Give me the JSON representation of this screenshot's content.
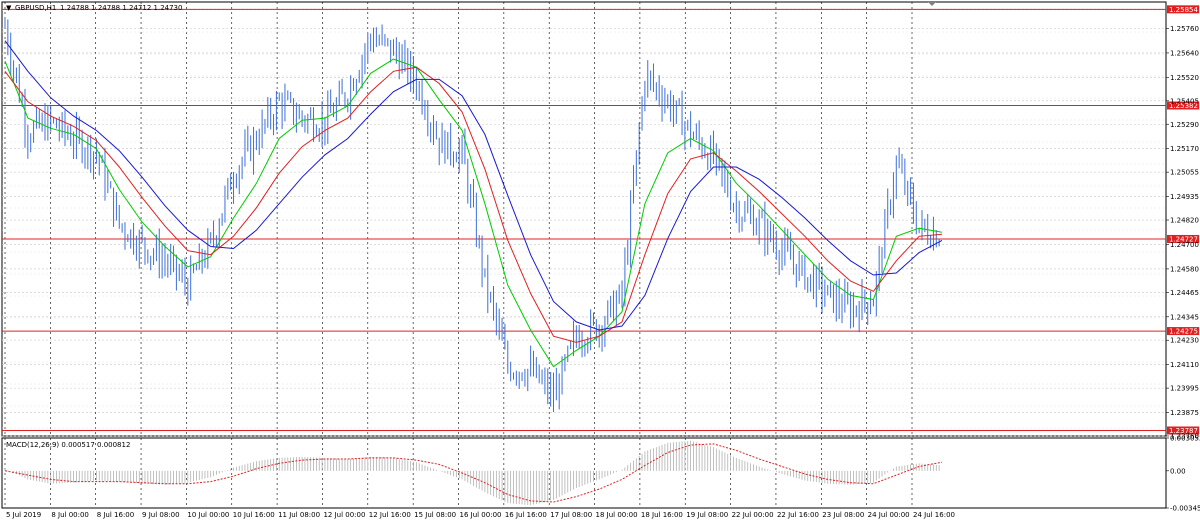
{
  "header": {
    "symbol": "GBPUSD,H1",
    "ohlc": "1.24788 1.24788 1.24712 1.24730"
  },
  "macd_header": "MACD(12,26,9) 0.000517 0.000812",
  "colors": {
    "candle": "#3d6fd9",
    "ma_fast": "#00cc00",
    "ma_mid": "#e02020",
    "ma_slow": "#1a1ad0",
    "level_line": "#e02020",
    "level_label_bg": "#e02020",
    "grid": "#c8c8c8",
    "macd_hist": "#b0b0b0",
    "macd_signal": "#e02020"
  },
  "chart_data": [
    {
      "type": "line",
      "name": "price",
      "ylim": [
        1.2376,
        1.2589
      ],
      "y_ticks": [
        "1.25760",
        "1.25640",
        "1.25520",
        "1.25405",
        "1.25290",
        "1.25170",
        "1.25055",
        "1.24935",
        "1.24820",
        "1.24700",
        "1.24580",
        "1.24465",
        "1.24345",
        "1.24230",
        "1.24110",
        "1.23995",
        "1.23875",
        "1.23760"
      ],
      "x_ticks": [
        "5 Jul 2019",
        "8 Jul 00:00",
        "8 Jul 16:00",
        "9 Jul 08:00",
        "10 Jul 00:00",
        "10 Jul 16:00",
        "11 Jul 08:00",
        "12 Jul 00:00",
        "12 Jul 16:00",
        "15 Jul 08:00",
        "16 Jul 00:00",
        "16 Jul 16:00",
        "17 Jul 08:00",
        "18 Jul 00:00",
        "18 Jul 16:00",
        "19 Jul 08:00",
        "22 Jul 00:00",
        "22 Jul 16:00",
        "23 Jul 08:00",
        "24 Jul 00:00",
        "24 Jul 16:00"
      ],
      "x": [
        "5 Jul 2019",
        "5 Jul 16:00",
        "8 Jul 00:00",
        "8 Jul 08:00",
        "8 Jul 16:00",
        "9 Jul 00:00",
        "9 Jul 08:00",
        "9 Jul 16:00",
        "10 Jul 00:00",
        "10 Jul 08:00",
        "10 Jul 16:00",
        "11 Jul 00:00",
        "11 Jul 08:00",
        "11 Jul 16:00",
        "12 Jul 00:00",
        "12 Jul 08:00",
        "12 Jul 16:00",
        "15 Jul 00:00",
        "15 Jul 08:00",
        "15 Jul 16:00",
        "16 Jul 00:00",
        "16 Jul 08:00",
        "16 Jul 16:00",
        "17 Jul 00:00",
        "17 Jul 08:00",
        "17 Jul 16:00",
        "18 Jul 00:00",
        "18 Jul 08:00",
        "18 Jul 16:00",
        "19 Jul 00:00",
        "19 Jul 08:00",
        "19 Jul 16:00",
        "22 Jul 00:00",
        "22 Jul 08:00",
        "22 Jul 16:00",
        "23 Jul 00:00",
        "23 Jul 08:00",
        "23 Jul 16:00",
        "24 Jul 00:00",
        "24 Jul 08:00",
        "24 Jul 16:00",
        "25 Jul 00:00"
      ],
      "series": [
        {
          "values": [
            1.2577,
            1.2525,
            1.253,
            1.2522,
            1.2515,
            1.248,
            1.247,
            1.2462,
            1.245,
            1.247,
            1.2505,
            1.2522,
            1.254,
            1.2532,
            1.253,
            1.2545,
            1.2572,
            1.2565,
            1.255,
            1.252,
            1.2515,
            1.2452,
            1.241,
            1.2408,
            1.2395,
            1.2425,
            1.243,
            1.2445,
            1.2553,
            1.254,
            1.2525,
            1.2512,
            1.2488,
            1.248,
            1.2467,
            1.2455,
            1.2445,
            1.2438,
            1.2444,
            1.251,
            1.2478,
            1.2474
          ]
        },
        {
          "name": "MA fast",
          "values": [
            1.256,
            1.2532,
            1.2527,
            1.2524,
            1.2517,
            1.2497,
            1.2481,
            1.2469,
            1.2459,
            1.2464,
            1.2483,
            1.25,
            1.2522,
            1.2531,
            1.2532,
            1.2538,
            1.2554,
            1.2561,
            1.2557,
            1.2541,
            1.2526,
            1.249,
            1.245,
            1.2428,
            1.241,
            1.2418,
            1.2425,
            1.2437,
            1.249,
            1.2515,
            1.2522,
            1.2516,
            1.25,
            1.2489,
            1.2477,
            1.2465,
            1.2453,
            1.2445,
            1.2443,
            1.2474,
            1.2478,
            1.2476
          ]
        },
        {
          "name": "MA mid",
          "values": [
            1.2555,
            1.254,
            1.2533,
            1.2528,
            1.2521,
            1.2508,
            1.2493,
            1.2479,
            1.2467,
            1.2465,
            1.2474,
            1.2488,
            1.2505,
            1.2518,
            1.2526,
            1.2532,
            1.2545,
            1.2555,
            1.2557,
            1.2549,
            1.2535,
            1.2507,
            1.2472,
            1.2446,
            1.2425,
            1.2422,
            1.2425,
            1.2432,
            1.2465,
            1.2495,
            1.2512,
            1.2515,
            1.2506,
            1.2496,
            1.2485,
            1.2474,
            1.2462,
            1.2452,
            1.2447,
            1.2462,
            1.2474,
            1.2475
          ]
        },
        {
          "name": "MA slow",
          "values": [
            1.257,
            1.2555,
            1.2542,
            1.2533,
            1.2526,
            1.2516,
            1.2503,
            1.2489,
            1.2477,
            1.2469,
            1.2468,
            1.2477,
            1.249,
            1.2503,
            1.2514,
            1.2522,
            1.2534,
            1.2545,
            1.2551,
            1.2551,
            1.2543,
            1.2524,
            1.2494,
            1.2465,
            1.2442,
            1.2432,
            1.2428,
            1.243,
            1.2445,
            1.2473,
            1.2496,
            1.2508,
            1.2508,
            1.2502,
            1.2493,
            1.2483,
            1.2472,
            1.2462,
            1.2455,
            1.2456,
            1.2466,
            1.2472
          ]
        }
      ],
      "price_levels": [
        "1.25854",
        "1.25382",
        "1.24727",
        "1.24275",
        "1.23787"
      ]
    },
    {
      "type": "bar",
      "name": "MACD",
      "title": "MACD(12,26,9) 0.000517 0.000812",
      "ylim": [
        -0.003457,
        0.003052
      ],
      "y_ticks": [
        "0.003052",
        "0.00",
        "-0.003457"
      ],
      "x": [
        "5 Jul 2019",
        "5 Jul 16:00",
        "8 Jul 00:00",
        "8 Jul 08:00",
        "8 Jul 16:00",
        "9 Jul 00:00",
        "9 Jul 08:00",
        "9 Jul 16:00",
        "10 Jul 00:00",
        "10 Jul 08:00",
        "10 Jul 16:00",
        "11 Jul 00:00",
        "11 Jul 08:00",
        "11 Jul 16:00",
        "12 Jul 00:00",
        "12 Jul 08:00",
        "12 Jul 16:00",
        "15 Jul 00:00",
        "15 Jul 08:00",
        "15 Jul 16:00",
        "16 Jul 00:00",
        "16 Jul 08:00",
        "16 Jul 16:00",
        "17 Jul 00:00",
        "17 Jul 08:00",
        "17 Jul 16:00",
        "18 Jul 00:00",
        "18 Jul 08:00",
        "18 Jul 16:00",
        "19 Jul 00:00",
        "19 Jul 08:00",
        "19 Jul 16:00",
        "22 Jul 00:00",
        "22 Jul 08:00",
        "22 Jul 16:00",
        "23 Jul 00:00",
        "23 Jul 08:00",
        "23 Jul 16:00",
        "24 Jul 00:00",
        "24 Jul 08:00",
        "24 Jul 16:00",
        "25 Jul 00:00"
      ],
      "series": [
        {
          "name": "MACD",
          "values": [
            0.0002,
            -0.0008,
            -0.0012,
            -0.0011,
            -0.0009,
            -0.001,
            -0.0012,
            -0.0013,
            -0.0011,
            -0.0006,
            0.0003,
            0.0009,
            0.0012,
            0.0013,
            0.0012,
            0.0011,
            0.0013,
            0.0012,
            0.0008,
            0.0,
            -0.0008,
            -0.002,
            -0.003,
            -0.0032,
            -0.0027,
            -0.0016,
            -0.0008,
            0.0001,
            0.0018,
            0.0026,
            0.0028,
            0.0022,
            0.0012,
            0.0004,
            -0.0003,
            -0.0009,
            -0.0012,
            -0.0013,
            -0.0011,
            0.0004,
            0.0007,
            0.0005
          ]
        },
        {
          "name": "Signal",
          "values": [
            0.0,
            -0.0004,
            -0.0008,
            -0.001,
            -0.001,
            -0.001,
            -0.0011,
            -0.0012,
            -0.0012,
            -0.001,
            -0.0005,
            0.0002,
            0.0007,
            0.001,
            0.0011,
            0.0011,
            0.0012,
            0.0012,
            0.001,
            0.0006,
            -0.0002,
            -0.0011,
            -0.0022,
            -0.0028,
            -0.0029,
            -0.0024,
            -0.0017,
            -0.0008,
            0.0005,
            0.0017,
            0.0024,
            0.0025,
            0.0019,
            0.0011,
            0.0004,
            -0.0003,
            -0.0008,
            -0.0011,
            -0.0012,
            -0.0004,
            0.0004,
            0.0008
          ]
        }
      ]
    }
  ]
}
